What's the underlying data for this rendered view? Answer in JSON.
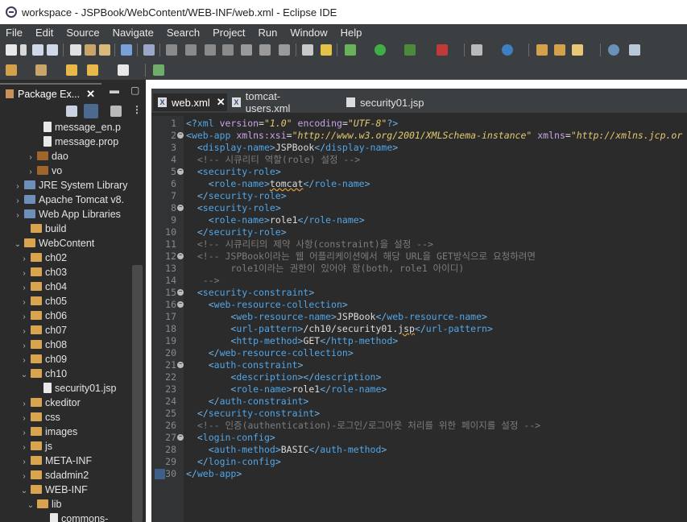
{
  "window": {
    "title": "workspace - JSPBook/WebContent/WEB-INF/web.xml - Eclipse IDE"
  },
  "menu": [
    "File",
    "Edit",
    "Source",
    "Navigate",
    "Search",
    "Project",
    "Run",
    "Window",
    "Help"
  ],
  "package_explorer": {
    "tab_label": "Package Ex...",
    "tree": [
      {
        "label": "message_en.p",
        "type": "file",
        "indent": 4,
        "expanded": null
      },
      {
        "label": "message.prop",
        "type": "file",
        "indent": 4,
        "expanded": null
      },
      {
        "label": "dao",
        "type": "package",
        "indent": 3,
        "expanded": false
      },
      {
        "label": "vo",
        "type": "package",
        "indent": 3,
        "expanded": false
      },
      {
        "label": "JRE System Library",
        "type": "library",
        "indent": 1,
        "expanded": false
      },
      {
        "label": "Apache Tomcat v8.",
        "type": "library",
        "indent": 1,
        "expanded": false
      },
      {
        "label": "Web App Libraries",
        "type": "library",
        "indent": 1,
        "expanded": false
      },
      {
        "label": "build",
        "type": "folder",
        "indent": 2,
        "expanded": null
      },
      {
        "label": "WebContent",
        "type": "folder",
        "indent": 1,
        "expanded": true
      },
      {
        "label": "ch02",
        "type": "folder",
        "indent": 2,
        "expanded": false
      },
      {
        "label": "ch03",
        "type": "folder",
        "indent": 2,
        "expanded": false
      },
      {
        "label": "ch04",
        "type": "folder",
        "indent": 2,
        "expanded": false
      },
      {
        "label": "ch05",
        "type": "folder",
        "indent": 2,
        "expanded": false
      },
      {
        "label": "ch06",
        "type": "folder",
        "indent": 2,
        "expanded": false
      },
      {
        "label": "ch07",
        "type": "folder",
        "indent": 2,
        "expanded": false
      },
      {
        "label": "ch08",
        "type": "folder",
        "indent": 2,
        "expanded": false
      },
      {
        "label": "ch09",
        "type": "folder",
        "indent": 2,
        "expanded": false
      },
      {
        "label": "ch10",
        "type": "folder",
        "indent": 2,
        "expanded": true
      },
      {
        "label": "security01.jsp",
        "type": "file",
        "indent": 4,
        "expanded": null
      },
      {
        "label": "ckeditor",
        "type": "folder",
        "indent": 2,
        "expanded": false
      },
      {
        "label": "css",
        "type": "folder",
        "indent": 2,
        "expanded": false
      },
      {
        "label": "images",
        "type": "folder",
        "indent": 2,
        "expanded": false
      },
      {
        "label": "js",
        "type": "folder",
        "indent": 2,
        "expanded": false
      },
      {
        "label": "META-INF",
        "type": "folder",
        "indent": 2,
        "expanded": false
      },
      {
        "label": "sdadmin2",
        "type": "folder",
        "indent": 2,
        "expanded": false
      },
      {
        "label": "WEB-INF",
        "type": "folder",
        "indent": 2,
        "expanded": true
      },
      {
        "label": "lib",
        "type": "folder",
        "indent": 3,
        "expanded": true
      },
      {
        "label": "commons-",
        "type": "file",
        "indent": 5,
        "expanded": null
      }
    ]
  },
  "editor": {
    "tabs": [
      {
        "label": "web.xml",
        "active": true,
        "icon": "xml-file-icon"
      },
      {
        "label": "tomcat-users.xml",
        "active": false,
        "icon": "xml-file-icon"
      },
      {
        "label": "security01.jsp",
        "active": false,
        "icon": "jsp-file-icon"
      }
    ],
    "lines": [
      {
        "n": "1",
        "fold": false,
        "segs": [
          [
            "b",
            "<?"
          ],
          [
            "t",
            "xml"
          ],
          [
            "x",
            " "
          ],
          [
            "a",
            "version"
          ],
          [
            "x",
            "="
          ],
          [
            "v",
            "\"1.0\""
          ],
          [
            "x",
            " "
          ],
          [
            "a",
            "encoding"
          ],
          [
            "x",
            "="
          ],
          [
            "v",
            "\"UTF-8\""
          ],
          [
            "b",
            "?>"
          ]
        ]
      },
      {
        "n": "2",
        "fold": true,
        "segs": [
          [
            "b",
            "<"
          ],
          [
            "t",
            "web-app"
          ],
          [
            "x",
            " "
          ],
          [
            "a",
            "xmlns:xsi"
          ],
          [
            "x",
            "="
          ],
          [
            "v",
            "\"http://www.w3.org/2001/XMLSchema-instance\""
          ],
          [
            "x",
            " "
          ],
          [
            "a",
            "xmlns"
          ],
          [
            "x",
            "="
          ],
          [
            "v",
            "\"http://xmlns.jcp.or"
          ]
        ]
      },
      {
        "n": "3",
        "fold": false,
        "segs": [
          [
            "x",
            "  "
          ],
          [
            "b",
            "<"
          ],
          [
            "t",
            "display-name"
          ],
          [
            "b",
            ">"
          ],
          [
            "x",
            "JSPBook"
          ],
          [
            "b",
            "</"
          ],
          [
            "t",
            "display-name"
          ],
          [
            "b",
            ">"
          ]
        ]
      },
      {
        "n": "4",
        "fold": false,
        "segs": [
          [
            "x",
            "  "
          ],
          [
            "c",
            "<!-- 시큐리티 역할(role) 설정 -->"
          ]
        ]
      },
      {
        "n": "5",
        "fold": true,
        "segs": [
          [
            "x",
            "  "
          ],
          [
            "b",
            "<"
          ],
          [
            "t",
            "security-role"
          ],
          [
            "b",
            ">"
          ]
        ]
      },
      {
        "n": "6",
        "fold": false,
        "segs": [
          [
            "x",
            "    "
          ],
          [
            "b",
            "<"
          ],
          [
            "t",
            "role-name"
          ],
          [
            "b",
            ">"
          ],
          [
            "q",
            "tomcat"
          ],
          [
            "b",
            "</"
          ],
          [
            "t",
            "role-name"
          ],
          [
            "b",
            ">"
          ]
        ]
      },
      {
        "n": "7",
        "fold": false,
        "segs": [
          [
            "x",
            "  "
          ],
          [
            "b",
            "</"
          ],
          [
            "t",
            "security-role"
          ],
          [
            "b",
            ">"
          ]
        ]
      },
      {
        "n": "8",
        "fold": true,
        "segs": [
          [
            "x",
            "  "
          ],
          [
            "b",
            "<"
          ],
          [
            "t",
            "security-role"
          ],
          [
            "b",
            ">"
          ]
        ]
      },
      {
        "n": "9",
        "fold": false,
        "segs": [
          [
            "x",
            "    "
          ],
          [
            "b",
            "<"
          ],
          [
            "t",
            "role-name"
          ],
          [
            "b",
            ">"
          ],
          [
            "x",
            "role1"
          ],
          [
            "b",
            "</"
          ],
          [
            "t",
            "role-name"
          ],
          [
            "b",
            ">"
          ]
        ]
      },
      {
        "n": "10",
        "fold": false,
        "segs": [
          [
            "x",
            "  "
          ],
          [
            "b",
            "</"
          ],
          [
            "t",
            "security-role"
          ],
          [
            "b",
            ">"
          ]
        ]
      },
      {
        "n": "11",
        "fold": false,
        "segs": [
          [
            "x",
            "  "
          ],
          [
            "c",
            "<!-- 시큐리티의 제약 사항(constraint)을 설정 -->"
          ]
        ]
      },
      {
        "n": "12",
        "fold": true,
        "segs": [
          [
            "x",
            "  "
          ],
          [
            "c",
            "<!-- JSPBook이라는 웹 어플리케이션에서 해당 URL을 GET방식으로 요청하려면"
          ]
        ]
      },
      {
        "n": "13",
        "fold": false,
        "segs": [
          [
            "c",
            "        role1이라는 권한이 있어야 함(both, role1 아이디)"
          ]
        ]
      },
      {
        "n": "14",
        "fold": false,
        "segs": [
          [
            "c",
            "   -->"
          ]
        ]
      },
      {
        "n": "15",
        "fold": true,
        "segs": [
          [
            "x",
            "  "
          ],
          [
            "b",
            "<"
          ],
          [
            "t",
            "security-constraint"
          ],
          [
            "b",
            ">"
          ]
        ]
      },
      {
        "n": "16",
        "fold": true,
        "segs": [
          [
            "x",
            "    "
          ],
          [
            "b",
            "<"
          ],
          [
            "t",
            "web-resource-collection"
          ],
          [
            "b",
            ">"
          ]
        ]
      },
      {
        "n": "17",
        "fold": false,
        "segs": [
          [
            "x",
            "        "
          ],
          [
            "b",
            "<"
          ],
          [
            "t",
            "web-resource-name"
          ],
          [
            "b",
            ">"
          ],
          [
            "x",
            "JSPBook"
          ],
          [
            "b",
            "</"
          ],
          [
            "t",
            "web-resource-name"
          ],
          [
            "b",
            ">"
          ]
        ]
      },
      {
        "n": "18",
        "fold": false,
        "segs": [
          [
            "x",
            "        "
          ],
          [
            "b",
            "<"
          ],
          [
            "t",
            "url-pattern"
          ],
          [
            "b",
            ">"
          ],
          [
            "x",
            "/ch10/security01."
          ],
          [
            "q",
            "jsp"
          ],
          [
            "b",
            "</"
          ],
          [
            "t",
            "url-pattern"
          ],
          [
            "b",
            ">"
          ]
        ]
      },
      {
        "n": "19",
        "fold": false,
        "segs": [
          [
            "x",
            "        "
          ],
          [
            "b",
            "<"
          ],
          [
            "t",
            "http-method"
          ],
          [
            "b",
            ">"
          ],
          [
            "x",
            "GET"
          ],
          [
            "b",
            "</"
          ],
          [
            "t",
            "http-method"
          ],
          [
            "b",
            ">"
          ]
        ]
      },
      {
        "n": "20",
        "fold": false,
        "segs": [
          [
            "x",
            "    "
          ],
          [
            "b",
            "</"
          ],
          [
            "t",
            "web-resource-collection"
          ],
          [
            "b",
            ">"
          ]
        ]
      },
      {
        "n": "21",
        "fold": true,
        "segs": [
          [
            "x",
            "    "
          ],
          [
            "b",
            "<"
          ],
          [
            "t",
            "auth-constraint"
          ],
          [
            "b",
            ">"
          ]
        ]
      },
      {
        "n": "22",
        "fold": false,
        "segs": [
          [
            "x",
            "        "
          ],
          [
            "b",
            "<"
          ],
          [
            "t",
            "description"
          ],
          [
            "b",
            "></"
          ],
          [
            "t",
            "description"
          ],
          [
            "b",
            ">"
          ]
        ]
      },
      {
        "n": "23",
        "fold": false,
        "segs": [
          [
            "x",
            "        "
          ],
          [
            "b",
            "<"
          ],
          [
            "t",
            "role-name"
          ],
          [
            "b",
            ">"
          ],
          [
            "x",
            "role1"
          ],
          [
            "b",
            "</"
          ],
          [
            "t",
            "role-name"
          ],
          [
            "b",
            ">"
          ]
        ]
      },
      {
        "n": "24",
        "fold": false,
        "segs": [
          [
            "x",
            "    "
          ],
          [
            "b",
            "</"
          ],
          [
            "t",
            "auth-constraint"
          ],
          [
            "b",
            ">"
          ]
        ]
      },
      {
        "n": "25",
        "fold": false,
        "segs": [
          [
            "x",
            "  "
          ],
          [
            "b",
            "</"
          ],
          [
            "t",
            "security-constraint"
          ],
          [
            "b",
            ">"
          ]
        ]
      },
      {
        "n": "26",
        "fold": false,
        "segs": [
          [
            "x",
            "  "
          ],
          [
            "c",
            "<!-- 인증(authentication)-로그인/로그아웃 처리를 위한 페이지를 설정 -->"
          ]
        ]
      },
      {
        "n": "27",
        "fold": true,
        "segs": [
          [
            "x",
            "  "
          ],
          [
            "b",
            "<"
          ],
          [
            "t",
            "login-config"
          ],
          [
            "b",
            ">"
          ]
        ]
      },
      {
        "n": "28",
        "fold": false,
        "segs": [
          [
            "x",
            "    "
          ],
          [
            "b",
            "<"
          ],
          [
            "t",
            "auth-method"
          ],
          [
            "b",
            ">"
          ],
          [
            "x",
            "BASIC"
          ],
          [
            "b",
            "</"
          ],
          [
            "t",
            "auth-method"
          ],
          [
            "b",
            ">"
          ]
        ]
      },
      {
        "n": "29",
        "fold": false,
        "segs": [
          [
            "x",
            "  "
          ],
          [
            "b",
            "</"
          ],
          [
            "t",
            "login-config"
          ],
          [
            "b",
            ">"
          ]
        ]
      },
      {
        "n": "30",
        "fold": false,
        "segs": [
          [
            "b",
            "</"
          ],
          [
            "t",
            "web-app"
          ],
          [
            "b",
            ">"
          ]
        ]
      }
    ]
  },
  "colors": {
    "menubar_bg": "#3c3f41",
    "editor_bg": "#2b2b2b",
    "tag": "#51a6e8",
    "attribute": "#c8a4e8",
    "value": "#e3c96f",
    "comment": "#7c7c7c"
  }
}
